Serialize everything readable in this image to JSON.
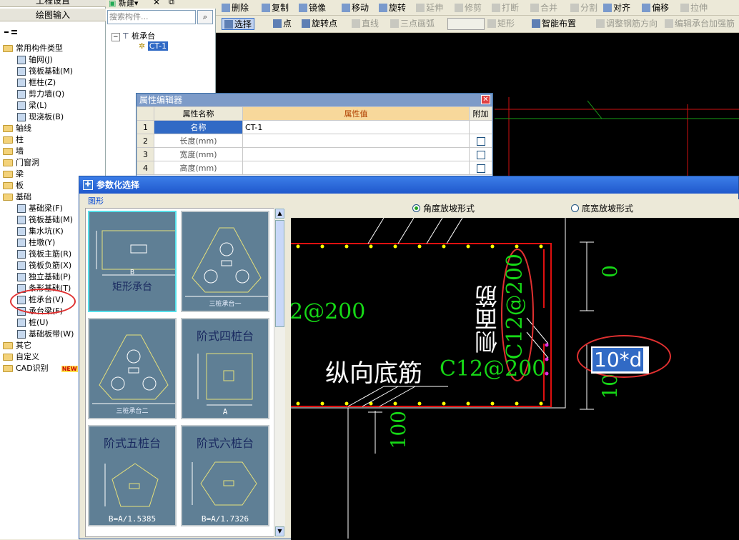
{
  "left_nav": {
    "top_button": "工程设置",
    "draw_button": "绘图输入",
    "tree": [
      {
        "label": "常用构件类型",
        "level": 0,
        "type": "folder",
        "expanded": true
      },
      {
        "label": "轴网(J)",
        "level": 1,
        "type": "item"
      },
      {
        "label": "筏板基础(M)",
        "level": 1,
        "type": "item"
      },
      {
        "label": "框柱(Z)",
        "level": 1,
        "type": "item"
      },
      {
        "label": "剪力墙(Q)",
        "level": 1,
        "type": "item"
      },
      {
        "label": "梁(L)",
        "level": 1,
        "type": "item"
      },
      {
        "label": "现浇板(B)",
        "level": 1,
        "type": "item"
      },
      {
        "label": "轴线",
        "level": 0,
        "type": "folder"
      },
      {
        "label": "柱",
        "level": 0,
        "type": "folder"
      },
      {
        "label": "墙",
        "level": 0,
        "type": "folder"
      },
      {
        "label": "门窗洞",
        "level": 0,
        "type": "folder"
      },
      {
        "label": "梁",
        "level": 0,
        "type": "folder"
      },
      {
        "label": "板",
        "level": 0,
        "type": "folder"
      },
      {
        "label": "基础",
        "level": 0,
        "type": "folder",
        "expanded": true
      },
      {
        "label": "基础梁(F)",
        "level": 1,
        "type": "item"
      },
      {
        "label": "筏板基础(M)",
        "level": 1,
        "type": "item"
      },
      {
        "label": "集水坑(K)",
        "level": 1,
        "type": "item"
      },
      {
        "label": "柱墩(Y)",
        "level": 1,
        "type": "item"
      },
      {
        "label": "筏板主筋(R)",
        "level": 1,
        "type": "item"
      },
      {
        "label": "筏板负筋(X)",
        "level": 1,
        "type": "item"
      },
      {
        "label": "独立基础(P)",
        "level": 1,
        "type": "item"
      },
      {
        "label": "条形基础(T)",
        "level": 1,
        "type": "item"
      },
      {
        "label": "桩承台(V)",
        "level": 1,
        "type": "item",
        "highlight": true
      },
      {
        "label": "承台梁(F)",
        "level": 1,
        "type": "item"
      },
      {
        "label": "桩(U)",
        "level": 1,
        "type": "item"
      },
      {
        "label": "基础板带(W)",
        "level": 1,
        "type": "item"
      },
      {
        "label": "其它",
        "level": 0,
        "type": "folder"
      },
      {
        "label": "自定义",
        "level": 0,
        "type": "folder"
      },
      {
        "label": "CAD识别",
        "level": 0,
        "type": "folder",
        "badge": "NEW"
      }
    ]
  },
  "component_list": {
    "new_button": "新建",
    "search_placeholder": "搜索构件...",
    "tree_root": "桩承台",
    "tree_child": "CT-1"
  },
  "toolbar1": {
    "items": [
      "删除",
      "复制",
      "镜像",
      "移动",
      "旋转",
      "延伸",
      "修剪",
      "打断",
      "合并",
      "分割",
      "对齐",
      "偏移",
      "拉伸"
    ]
  },
  "toolbar2": {
    "items": [
      "选择",
      "点",
      "旋转点",
      "直线",
      "三点画弧",
      "矩形",
      "智能布置",
      "调整钢筋方向",
      "编辑承台加强筋"
    ]
  },
  "prop_editor": {
    "title": "属性编辑器",
    "col_name": "属性名称",
    "col_value": "属性值",
    "col_extra": "附加",
    "rows": [
      {
        "n": "1",
        "name": "名称",
        "value": "CT-1"
      },
      {
        "n": "2",
        "name": "长度(mm)",
        "value": ""
      },
      {
        "n": "3",
        "name": "宽度(mm)",
        "value": ""
      },
      {
        "n": "4",
        "name": "高度(mm)",
        "value": ""
      }
    ]
  },
  "param_dialog": {
    "title": "参数化选择",
    "group_label": "图形",
    "radio_a": "角度放坡形式",
    "radio_b": "底宽放坡形式",
    "thumbs": [
      {
        "title": "",
        "caption": "矩形承台",
        "sub": "B"
      },
      {
        "title": "",
        "caption": "三桩承台一",
        "sub": ""
      },
      {
        "title": "",
        "caption": "三桩承台二",
        "sub": ""
      },
      {
        "title": "阶式四桩台",
        "caption": "",
        "sub": "A"
      },
      {
        "title": "阶式五桩台",
        "caption": "",
        "sub": "B=A/1.5385"
      },
      {
        "title": "阶式六桩台",
        "caption": "",
        "sub": "B=A/1.7326"
      }
    ],
    "cad_text": {
      "left_green": "2@200",
      "side": "侧面筋",
      "side_green": "C12@200",
      "bottom_white": "纵向底筋",
      "bottom_green": "C12@200",
      "dim_top": "0",
      "dim_bottom": "100",
      "dim_right": "10",
      "input_value": "10*d"
    }
  }
}
